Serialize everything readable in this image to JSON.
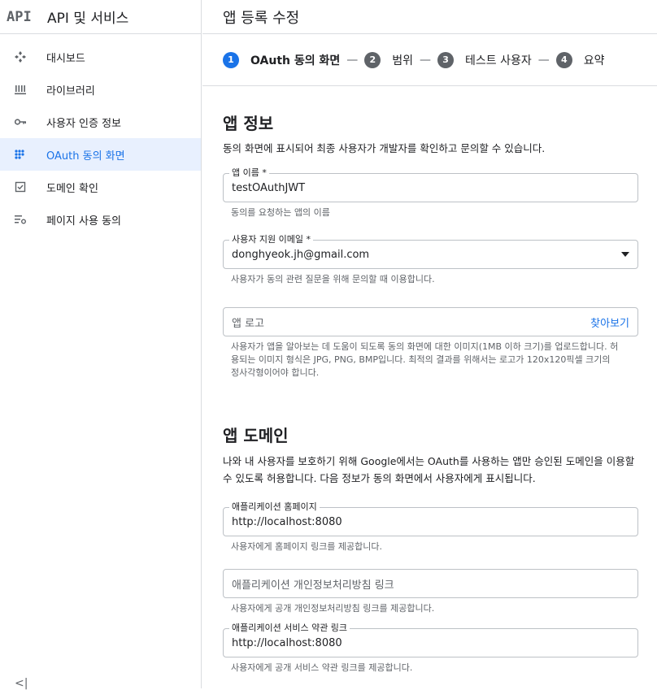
{
  "sidebar": {
    "logo": "API",
    "title": "API 및 서비스",
    "items": [
      {
        "label": "대시보드",
        "icon": "dashboard-icon"
      },
      {
        "label": "라이브러리",
        "icon": "library-icon"
      },
      {
        "label": "사용자 인증 정보",
        "icon": "key-icon"
      },
      {
        "label": "OAuth 동의 화면",
        "icon": "consent-icon",
        "active": true
      },
      {
        "label": "도메인 확인",
        "icon": "checkbox-icon"
      },
      {
        "label": "페이지 사용 동의",
        "icon": "settings-list-icon"
      }
    ],
    "collapse_glyph": "<|"
  },
  "page": {
    "title": "앱 등록 수정"
  },
  "stepper": {
    "steps": [
      {
        "num": "1",
        "label": "OAuth 동의 화면",
        "active": true
      },
      {
        "num": "2",
        "label": "범위"
      },
      {
        "num": "3",
        "label": "테스트 사용자"
      },
      {
        "num": "4",
        "label": "요약"
      }
    ],
    "separator": "—"
  },
  "app_info": {
    "title": "앱 정보",
    "desc": "동의 화면에 표시되어 최종 사용자가 개발자를 확인하고 문의할 수 있습니다.",
    "app_name": {
      "label": "앱 이름 *",
      "value": "testOAuthJWT",
      "hint": "동의를 요청하는 앱의 이름"
    },
    "support_email": {
      "label": "사용자 지원 이메일 *",
      "value": "donghyeok.jh@gmail.com",
      "hint": "사용자가 동의 관련 질문을 위해 문의할 때 이용합니다."
    },
    "logo": {
      "placeholder": "앱 로고",
      "browse": "찾아보기",
      "hint": "사용자가 앱을 알아보는 데 도움이 되도록 동의 화면에 대한 이미지(1MB 이하 크기)를 업로드합니다. 허용되는 이미지 형식은 JPG, PNG, BMP입니다. 최적의 결과를 위해서는 로고가 120x120픽셀 크기의 정사각형이어야 합니다."
    }
  },
  "app_domain": {
    "title": "앱 도메인",
    "desc": "나와 내 사용자를 보호하기 위해 Google에서는 OAuth를 사용하는 앱만 승인된 도메인을 이용할 수 있도록 허용합니다. 다음 정보가 동의 화면에서 사용자에게 표시됩니다.",
    "homepage": {
      "label": "애플리케이션 홈페이지",
      "value": "http://localhost:8080",
      "hint": "사용자에게 홈페이지 링크를 제공합니다."
    },
    "privacy": {
      "placeholder": "애플리케이션 개인정보처리방침 링크",
      "hint": "사용자에게 공개 개인정보처리방침 링크를 제공합니다."
    },
    "tos": {
      "label": "애플리케이션 서비스 약관 링크",
      "value": "http://localhost:8080",
      "hint": "사용자에게 공개 서비스 약관 링크를 제공합니다."
    }
  }
}
